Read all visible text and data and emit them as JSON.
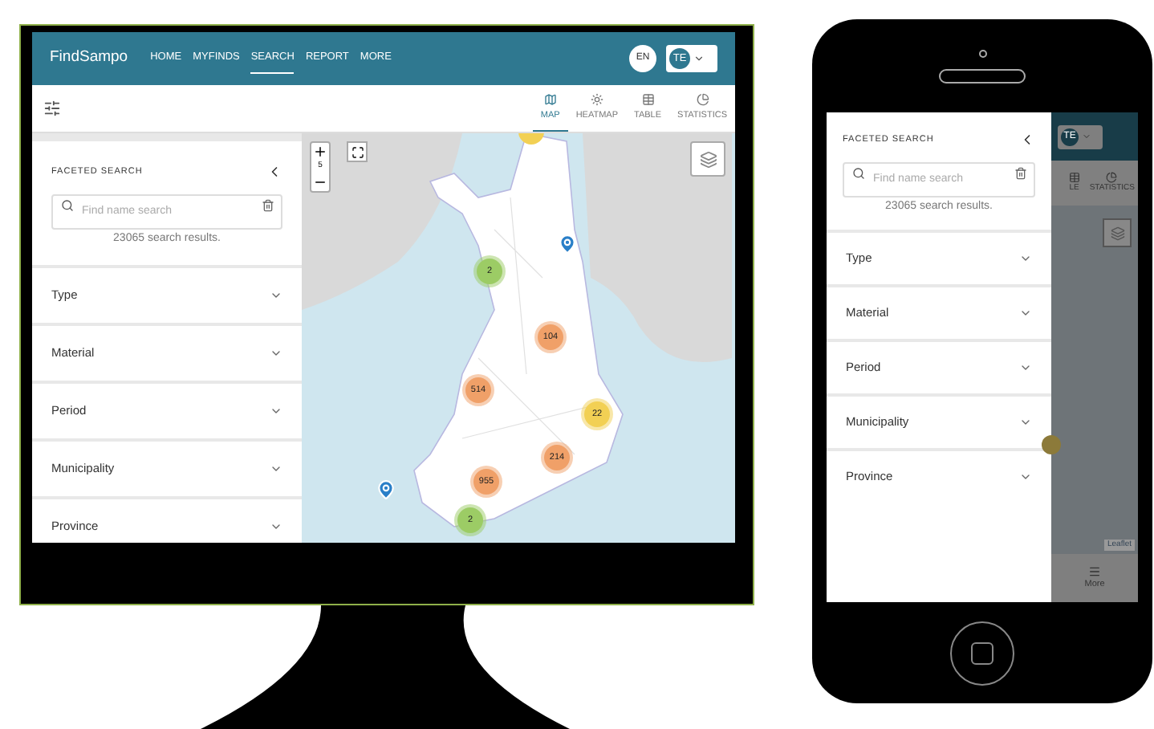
{
  "desktop": {
    "navbar": {
      "brand": "FindSampo",
      "links": [
        {
          "label": "HOME",
          "selected": false
        },
        {
          "label": "MYFINDS",
          "selected": false
        },
        {
          "label": "SEARCH",
          "selected": true
        },
        {
          "label": "REPORT",
          "selected": false
        },
        {
          "label": "MORE",
          "selected": false
        }
      ],
      "language": "EN",
      "avatar": "TE"
    },
    "view_tabs": [
      {
        "label": "MAP",
        "selected": true
      },
      {
        "label": "HEATMAP",
        "selected": false
      },
      {
        "label": "TABLE",
        "selected": false
      },
      {
        "label": "STATISTICS",
        "selected": false
      }
    ],
    "facets": {
      "title": "FACETED SEARCH",
      "placeholder": "Find name search",
      "results": "23065 search results.",
      "items": [
        {
          "label": "Type",
          "expanded": false
        },
        {
          "label": "Material",
          "expanded": false
        },
        {
          "label": "Period",
          "expanded": false
        },
        {
          "label": "Municipality",
          "expanded": false
        },
        {
          "label": "Province",
          "expanded": false
        }
      ]
    },
    "map": {
      "zoom_level": "5",
      "clusters": [
        {
          "count": "2",
          "color": "#9ccc65"
        },
        {
          "count": "104",
          "color": "#f0a068"
        },
        {
          "count": "514",
          "color": "#f0a068"
        },
        {
          "count": "22",
          "color": "#f2d054"
        },
        {
          "count": "214",
          "color": "#f0a068"
        },
        {
          "count": "955",
          "color": "#f0a068"
        },
        {
          "count": "2",
          "color": "#9ccc65"
        }
      ]
    }
  },
  "phone": {
    "avatar": "TE",
    "view_tabs": [
      {
        "label": "LE"
      },
      {
        "label": "STATISTICS"
      }
    ],
    "facets": {
      "title": "FACETED SEARCH",
      "placeholder": "Find name search",
      "results": "23065 search results.",
      "items": [
        {
          "label": "Type",
          "expanded": false
        },
        {
          "label": "Material",
          "expanded": false
        },
        {
          "label": "Period",
          "expanded": false
        },
        {
          "label": "Municipality",
          "expanded": false
        },
        {
          "label": "Province",
          "expanded": false
        }
      ]
    },
    "map_attribution": "Leaflet",
    "bottom_nav": {
      "label": "More"
    }
  }
}
